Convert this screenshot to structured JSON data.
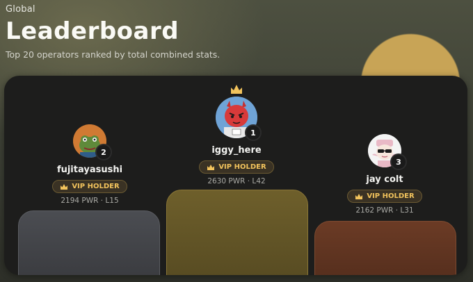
{
  "header": {
    "eyebrow": "Global",
    "title": "Leaderboard",
    "subtitle": "Top 20 operators ranked by total combined stats."
  },
  "players": [
    {
      "rank": "2",
      "name": "fujitayasushi",
      "badge": "VIP HOLDER",
      "stats": "2194 PWR · L15"
    },
    {
      "rank": "1",
      "name": "iggy_here",
      "badge": "VIP HOLDER",
      "stats": "2630 PWR · L42"
    },
    {
      "rank": "3",
      "name": "jay colt",
      "badge": "VIP HOLDER",
      "stats": "2162 PWR · L31"
    }
  ],
  "colors": {
    "gold": "#f2c35c",
    "podium_silver": "#4a4c51",
    "podium_gold": "#6f5f2a",
    "podium_bronze": "#6a3a24"
  },
  "icons": {
    "crown": "crown-icon"
  }
}
